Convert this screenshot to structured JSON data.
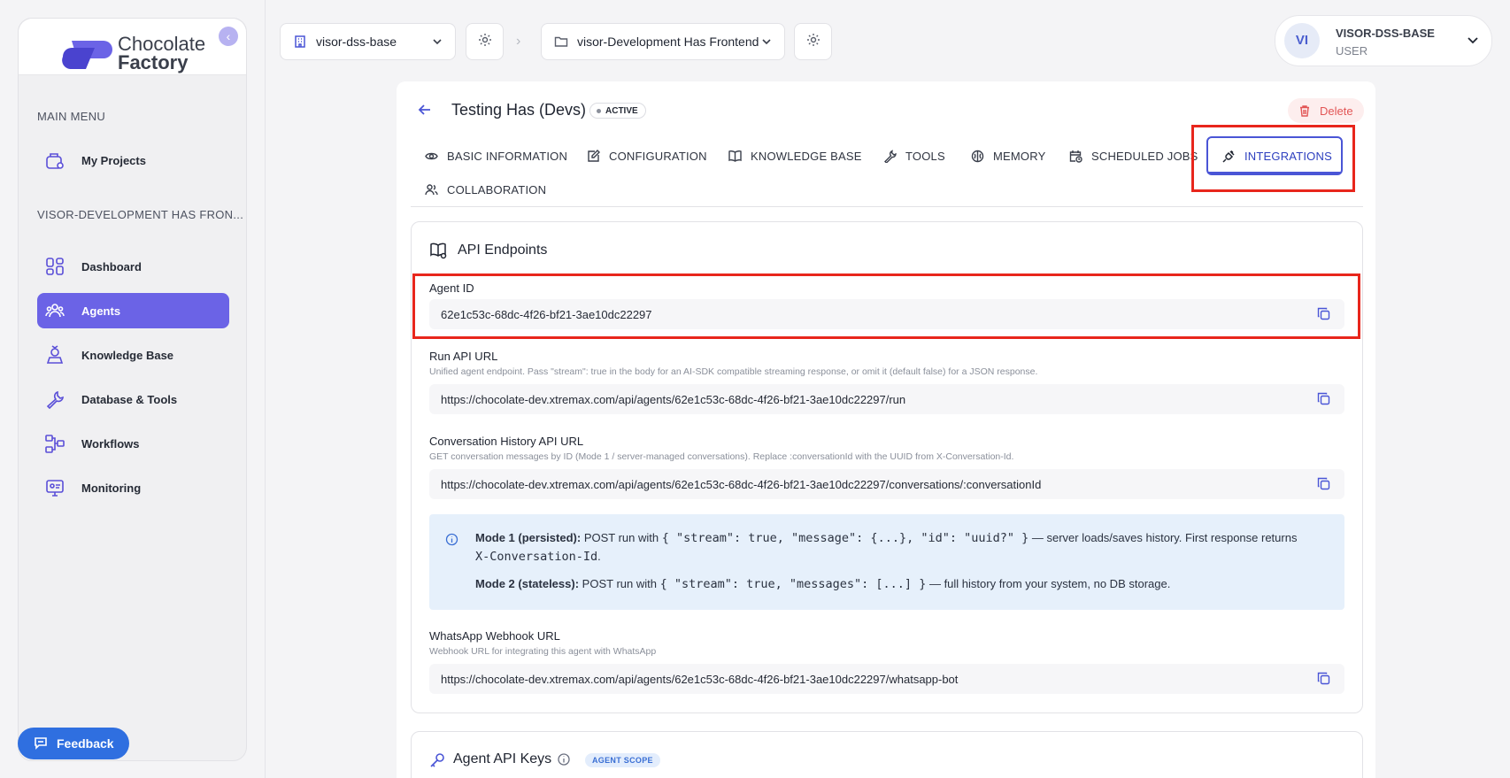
{
  "brand": {
    "line1": "Chocolate",
    "line2": "Factory"
  },
  "sidebar": {
    "main_menu_title": "MAIN MENU",
    "my_projects": "My Projects",
    "project_section_title": "VISOR-DEVELOPMENT HAS FRON...",
    "items": [
      {
        "label": "Dashboard",
        "icon": "dashboard-icon"
      },
      {
        "label": "Agents",
        "icon": "agents-icon",
        "active": true
      },
      {
        "label": "Knowledge Base",
        "icon": "knowledge-base-icon"
      },
      {
        "label": "Database & Tools",
        "icon": "wrench-icon"
      },
      {
        "label": "Workflows",
        "icon": "workflow-icon"
      },
      {
        "label": "Monitoring",
        "icon": "monitor-icon"
      }
    ],
    "feedback_label": "Feedback"
  },
  "topbar": {
    "organization": "visor-dss-base",
    "project": "visor-Development Has Frontend",
    "user": {
      "initials": "VI",
      "name": "VISOR-DSS-BASE",
      "role": "USER"
    }
  },
  "agent": {
    "title": "Testing Has (Devs)",
    "status": "ACTIVE",
    "delete_label": "Delete"
  },
  "tabs": [
    {
      "label": "BASIC INFORMATION",
      "icon": "eye-icon"
    },
    {
      "label": "CONFIGURATION",
      "icon": "edit-icon"
    },
    {
      "label": "KNOWLEDGE BASE",
      "icon": "book-icon"
    },
    {
      "label": "TOOLS",
      "icon": "tools-icon"
    },
    {
      "label": "MEMORY",
      "icon": "brain-icon"
    },
    {
      "label": "SCHEDULED JOBS",
      "icon": "calendar-clock-icon"
    },
    {
      "label": "INTEGRATIONS",
      "icon": "plug-icon",
      "active": true
    },
    {
      "label": "COLLABORATION",
      "icon": "users-icon"
    }
  ],
  "api_endpoints": {
    "title": "API Endpoints",
    "agent_id": {
      "label": "Agent ID",
      "value": "62e1c53c-68dc-4f26-bf21-3ae10dc22297"
    },
    "run_url": {
      "label": "Run API URL",
      "help": "Unified agent endpoint. Pass \"stream\": true in the body for an AI-SDK compatible streaming response, or omit it (default false) for a JSON response.",
      "value": "https://chocolate-dev.xtremax.com/api/agents/62e1c53c-68dc-4f26-bf21-3ae10dc22297/run"
    },
    "history_url": {
      "label": "Conversation History API URL",
      "help": "GET conversation messages by ID (Mode 1 / server-managed conversations). Replace :conversationId with the UUID from X-Conversation-Id.",
      "value": "https://chocolate-dev.xtremax.com/api/agents/62e1c53c-68dc-4f26-bf21-3ae10dc22297/conversations/:conversationId"
    },
    "info": {
      "mode1_label": "Mode 1 (persisted):",
      "mode1_prefix": "POST run with",
      "mode1_code": "{ \"stream\": true, \"message\": {...}, \"id\": \"uuid?\" }",
      "mode1_suffix": "— server loads/saves history. First response returns",
      "mode1_header": "X-Conversation-Id",
      "mode1_end": ".",
      "mode2_label": "Mode 2 (stateless):",
      "mode2_prefix": "POST run with",
      "mode2_code": "{ \"stream\": true, \"messages\": [...] }",
      "mode2_suffix": "— full history from your system, no DB storage."
    },
    "whatsapp_url": {
      "label": "WhatsApp Webhook URL",
      "help": "Webhook URL for integrating this agent with WhatsApp",
      "value": "https://chocolate-dev.xtremax.com/api/agents/62e1c53c-68dc-4f26-bf21-3ae10dc22297/whatsapp-bot"
    }
  },
  "agent_api_keys": {
    "title": "Agent API Keys",
    "scope_badge": "AGENT SCOPE"
  },
  "colors": {
    "accent": "#6b63e6",
    "highlight": "#e8261c",
    "feedback": "#2f6fe0",
    "danger": "#e25555"
  }
}
